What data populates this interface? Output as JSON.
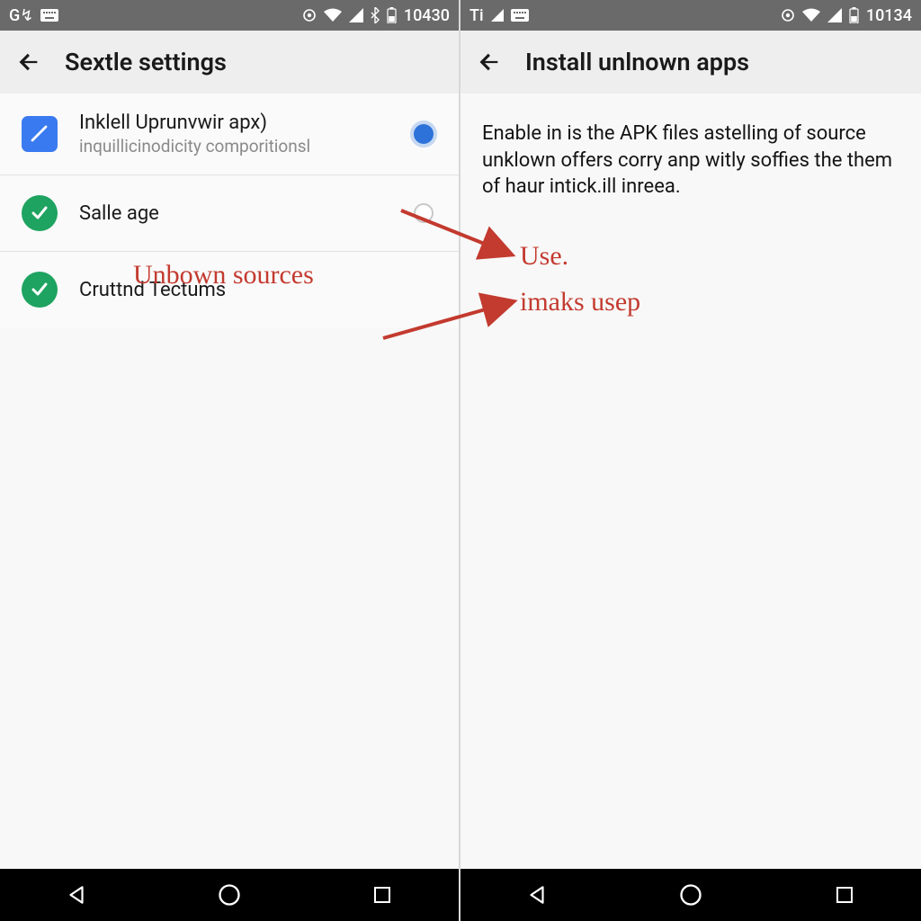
{
  "left": {
    "statusbar": {
      "left_text": "G↯",
      "time": "10430"
    },
    "header": {
      "title": "Sextle settings"
    },
    "rows": [
      {
        "title": "Inklell Uprunvwir apx)",
        "subtitle": "inquillicinodicity comporitionsl",
        "icon": "blue-box",
        "control": "radio_on"
      },
      {
        "title": "Salle age",
        "subtitle": "",
        "icon": "check",
        "control": "radio_off"
      },
      {
        "title": "Cruttnd Tectums",
        "subtitle": "",
        "icon": "check",
        "control": "none"
      }
    ]
  },
  "right": {
    "statusbar": {
      "left_text": "Ti",
      "time": "10134"
    },
    "header": {
      "title": "Install unlnown apps"
    },
    "description": "Enable in is the APK files astelling of source unklown offers corry anp witly soffies the them of haur intick.ill inreea."
  },
  "annotations": {
    "a1": "Unbown sources",
    "a2": "Use.",
    "a3": "imaks usep"
  }
}
